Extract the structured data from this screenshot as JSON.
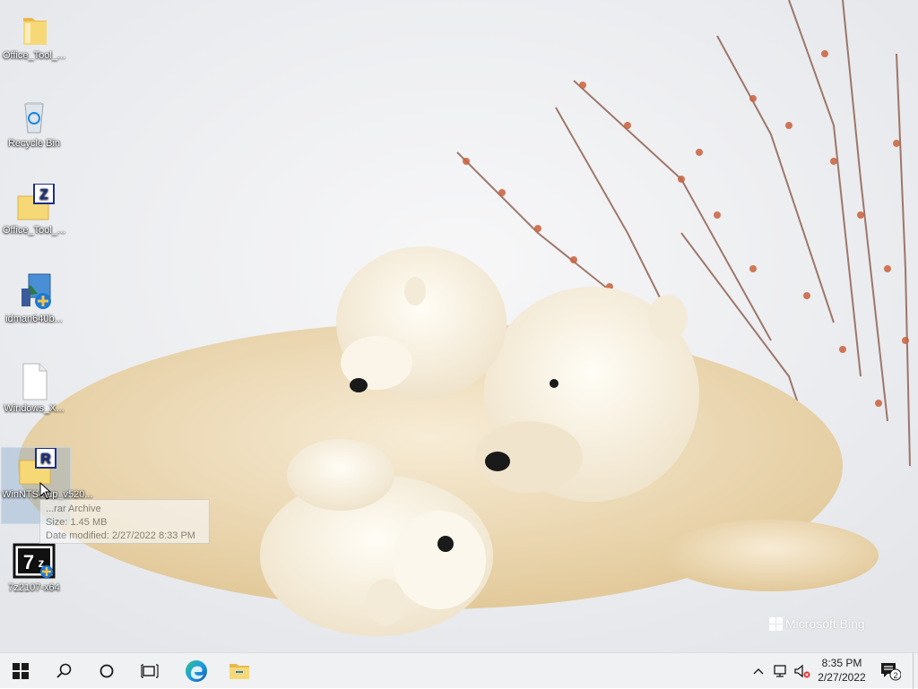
{
  "desktop": {
    "icons": [
      {
        "label": "Office_Tool_...",
        "icon": "folder-icon"
      },
      {
        "label": "Recycle Bin",
        "icon": "recycle-bin-icon"
      },
      {
        "label": "Office_Tool_...",
        "icon": "zip-archive-icon"
      },
      {
        "label": "idman640b...",
        "icon": "installer-icon"
      },
      {
        "label": "Windows_X...",
        "icon": "file-icon"
      },
      {
        "label": "WinNTSetup_v520...",
        "icon": "rar-archive-icon"
      },
      {
        "label": "7z2107-x64",
        "icon": "7zip-installer-icon"
      }
    ],
    "tooltip": {
      "line1": "...rar Archive",
      "line2": "Size: 1.45 MB",
      "line3": "Date modified: 2/27/2022 8:33 PM"
    },
    "watermark": "Microsoft Bing"
  },
  "taskbar": {
    "buttons": [
      "start-icon",
      "search-icon",
      "cortana-icon",
      "task-view-icon",
      "edge-icon",
      "file-explorer-icon"
    ],
    "tray": [
      "chevron-up-icon",
      "network-icon",
      "volume-muted-icon"
    ],
    "time": "8:35 PM",
    "date": "2/27/2022",
    "notification_count": "2"
  },
  "colors": {
    "accent": "#0078d7",
    "folder": "#f3d56e",
    "taskbar": "#f0f1f3"
  }
}
